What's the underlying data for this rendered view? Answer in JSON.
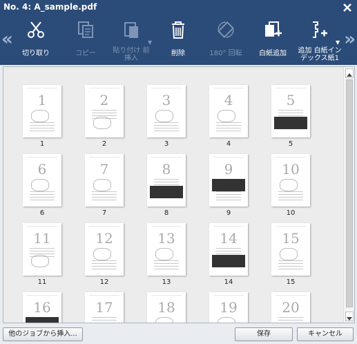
{
  "window": {
    "title": "No. 4: A_sample.pdf"
  },
  "toolbar": {
    "cut": "切り取り",
    "copy": "コピー",
    "paste": "貼り付け 前挿入",
    "delete": "削除",
    "rotate": "180° 回転",
    "blank": "白紙追加",
    "index": "追加 白紙インデックス紙1"
  },
  "pages": [
    "1",
    "2",
    "3",
    "4",
    "5",
    "6",
    "7",
    "8",
    "9",
    "10",
    "11",
    "12",
    "13",
    "14",
    "15",
    "16",
    "17",
    "18",
    "19",
    "20"
  ],
  "footer": {
    "insert_from_job": "他のジョブから挿入...",
    "save": "保存",
    "cancel": "キャンセル"
  }
}
